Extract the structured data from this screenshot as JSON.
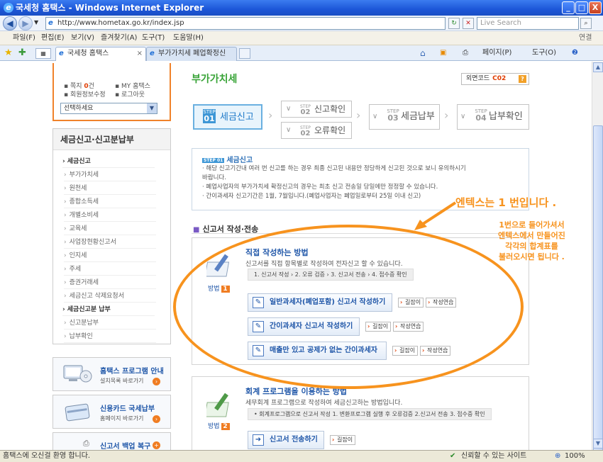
{
  "window": {
    "title": "국세청 홈택스 - Windows Internet Explorer",
    "min": "_",
    "max": "□",
    "close": "X"
  },
  "address": {
    "url": "http://www.hometax.go.kr/index.jsp",
    "search_placeholder": "Live Search"
  },
  "menu": [
    "파일(F)",
    "편집(E)",
    "보기(V)",
    "즐겨찾기(A)",
    "도구(T)",
    "도움말(H)"
  ],
  "menu_right": "연결",
  "tabs": [
    {
      "label": "국세청 홈택스",
      "close": "×"
    },
    {
      "label": "부가가치세 폐업확정신고..."
    }
  ],
  "toolbar_right": {
    "page": "페이지(P)",
    "tools": "도구(O)"
  },
  "login": {
    "note_label": "쪽지",
    "note_count": "0",
    "note_unit": "건",
    "my_hometax": "MY 홈택스",
    "edit_info": "회원정보수정",
    "logout": "로그아웃",
    "select_value": "선택하세요"
  },
  "sidebar": {
    "header": "세금신고·신고분납부",
    "items": [
      {
        "label": "세금신고",
        "type": "sec"
      },
      {
        "label": "부가가치세",
        "type": "sub"
      },
      {
        "label": "원천세",
        "type": "sub"
      },
      {
        "label": "종합소득세",
        "type": "sub"
      },
      {
        "label": "개별소비세",
        "type": "sub"
      },
      {
        "label": "교육세",
        "type": "sub"
      },
      {
        "label": "사업장현황신고서",
        "type": "sub"
      },
      {
        "label": "인지세",
        "type": "sub"
      },
      {
        "label": "주세",
        "type": "sub"
      },
      {
        "label": "증권거래세",
        "type": "sub"
      },
      {
        "label": "세금신고 삭제요청서",
        "type": "sub"
      },
      {
        "label": "세금신고분 납부",
        "type": "sec"
      },
      {
        "label": "신고분납부",
        "type": "sub"
      },
      {
        "label": "납부확인",
        "type": "sub"
      }
    ],
    "banners": [
      {
        "title": "홈택스 프로그램 안내",
        "sub": "설치목록 바로가기"
      },
      {
        "title": "신용카드 국세납부",
        "sub": "홈페이지 바로가기"
      },
      {
        "title": "신고서 백업 복구"
      }
    ]
  },
  "main": {
    "title": "부가가치세",
    "screen_code_label": "외면코드",
    "screen_code": "C02",
    "help": "?",
    "steps": [
      {
        "step": "STEP",
        "num": "01",
        "label": "세금신고"
      },
      {
        "step": "STEP",
        "num": "02",
        "label": "신고확인"
      },
      {
        "step": "STEP",
        "num": "02",
        "label": "오류확인"
      },
      {
        "step": "STEP",
        "num": "03",
        "label": "세금납부"
      },
      {
        "step": "STEP",
        "num": "04",
        "label": "납부확인"
      }
    ],
    "notice": {
      "tag": "STEP 01",
      "title": "세금신고",
      "lines": [
        "· 해당 신고기간내 여러 번 신고를 하는 경우 최종 신고된 내용만 정당하게 신고된 것으로 보니 유의하시기",
        "  바랍니다.",
        "· 폐업사업자의 부가가치세 확정신고의 경우는 최초 신고 전송일 당일에만 정정할 수 있습니다.",
        "· 간이과세자 신고기간은 1월, 7월입니다.(폐업사업자는 폐업일로부터 25일 이내 신고)"
      ]
    },
    "section_title": "신고서 작성·전송",
    "methods": [
      {
        "title": "직접 작성하는 방법",
        "desc": "신고서를 직접 항목별로 작성하여 전자신고 할 수 있습니다.",
        "flow": "1. 신고서 작성  ›  2. 오류 검증  ›  3. 신고서 전송  ›  4. 접수증 확인",
        "badge": "방법",
        "badge_num": "1",
        "buttons": [
          {
            "label": "일반과세자(폐업포함) 신고서 작성하기",
            "guide": "길잡이",
            "practice": "작성연습"
          },
          {
            "label": "간이과세자 신고서 작성하기",
            "guide": "길잡이",
            "practice": "작성연습"
          },
          {
            "label": "매출만 있고 공제가 없는 간이과세자",
            "guide": "길잡이",
            "practice": "작성연습"
          }
        ]
      },
      {
        "title": "회계 프로그램을 이용하는 방법",
        "desc": "세무회계 프로그램으로 작성하여 세금신고하는 방법입니다.",
        "flow": "• 회계프로그램으로 신고서 작성   1. 변환프로그램 실행 후 오류검증   2.신고서 전송   3. 접수증 확인",
        "badge": "방법",
        "badge_num": "2",
        "buttons": [
          {
            "label": "신고서 전송하기",
            "guide": "길잡이"
          }
        ]
      }
    ]
  },
  "annotation": {
    "headline": "엔텍스는 1 번입니다 .",
    "line1": "1번으로 들어가셔서",
    "line2": "엔텍스에서 만들어진",
    "line3": "각각의 합계표를",
    "line4": "불러오시면 됩니다 .",
    "color": "#f7931e"
  },
  "status": {
    "left": "홈택스에 오신걸 환영 합니다.",
    "zone": "신뢰할 수 있는 사이트",
    "zoom": "100%"
  }
}
